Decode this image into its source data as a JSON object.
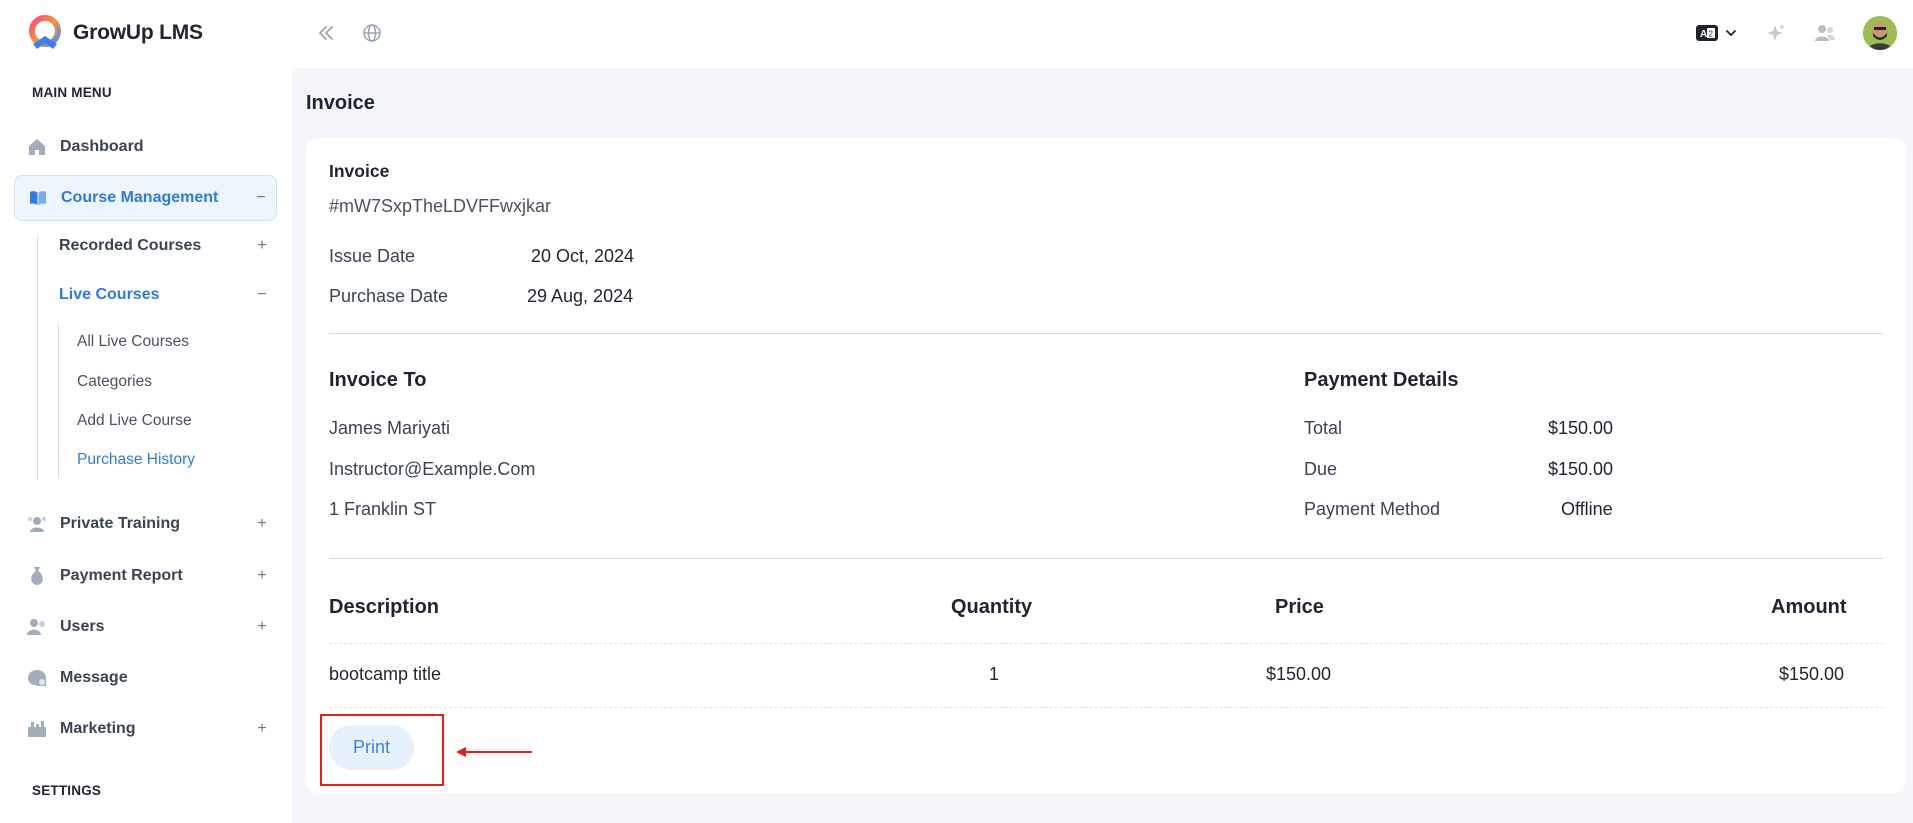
{
  "app": {
    "name": "GrowUp LMS"
  },
  "topbar": {
    "collapse_icon": "double-chevron-left-icon",
    "globe_icon": "globe-icon",
    "language_icon": "translate-icon",
    "sparkle_icon": "sparkle-icon",
    "users_icon": "users-icon"
  },
  "sidebar": {
    "main_menu_label": "MAIN MENU",
    "settings_label": "SETTINGS",
    "items": {
      "dashboard": "Dashboard",
      "course_management": "Course Management",
      "recorded_courses": "Recorded Courses",
      "live_courses": "Live Courses",
      "all_live_courses": "All Live Courses",
      "categories": "Categories",
      "add_live_course": "Add Live Course",
      "purchase_history": "Purchase History",
      "private_training": "Private Training",
      "payment_report": "Payment Report",
      "users": "Users",
      "message": "Message",
      "marketing": "Marketing"
    },
    "plus": "+",
    "minus": "−"
  },
  "page": {
    "title": "Invoice"
  },
  "invoice": {
    "label": "Invoice",
    "id": "#mW7SxpTheLDVFFwxjkar",
    "issue_date_label": "Issue Date",
    "issue_date": "20 Oct, 2024",
    "purchase_date_label": "Purchase Date",
    "purchase_date": "29 Aug, 2024",
    "invoice_to": {
      "heading": "Invoice To",
      "name": "James Mariyati",
      "email": "Instructor@Example.Com",
      "address": "1 Franklin ST"
    },
    "payment_details": {
      "heading": "Payment Details",
      "total_label": "Total",
      "total": "$150.00",
      "due_label": "Due",
      "due": "$150.00",
      "method_label": "Payment Method",
      "method": "Offline"
    },
    "table": {
      "headers": [
        "Description",
        "Quantity",
        "Price",
        "Amount"
      ],
      "rows": [
        [
          "bootcamp title",
          "1",
          "$150.00",
          "$150.00"
        ]
      ]
    },
    "print_label": "Print"
  },
  "colors": {
    "accent": "#2f7be0",
    "annotation": "#e0211e"
  }
}
